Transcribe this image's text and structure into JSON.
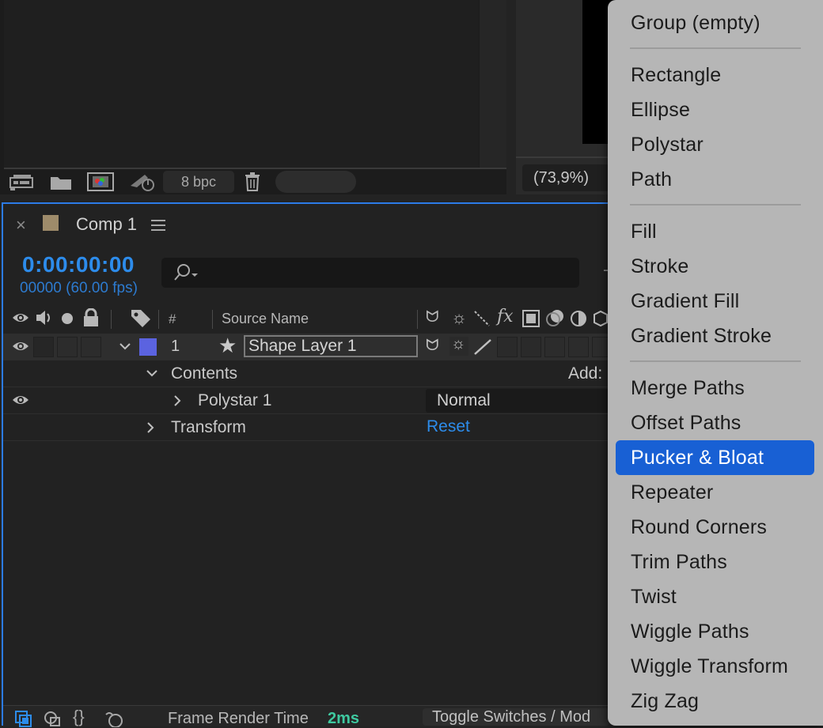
{
  "viewer_bar": {
    "bpc_label": "8 bpc",
    "zoom_label": "(73,9%)"
  },
  "comp_tab": {
    "title": "Comp 1",
    "label_color": "#9e8b6a"
  },
  "timeline": {
    "timecode": "0:00:00:00",
    "frame_info": "00000 (60.00 fps)",
    "search_placeholder": "",
    "columns": {
      "number": "#",
      "source_name": "Source Name"
    },
    "layer": {
      "number": "1",
      "name": "Shape Layer 1",
      "label_color": "#5b63e0"
    },
    "contents_label": "Contents",
    "add_label": "Add:",
    "polystar_label": "Polystar 1",
    "blend_mode": "Normal",
    "transform_label": "Transform",
    "reset_label": "Reset"
  },
  "status_bar": {
    "frame_render_label": "Frame Render Time",
    "frame_render_value": "2ms",
    "toggle_label": "Toggle Switches / Mod"
  },
  "add_menu": {
    "group1": [
      "Group (empty)"
    ],
    "group2": [
      "Rectangle",
      "Ellipse",
      "Polystar",
      "Path"
    ],
    "group3": [
      "Fill",
      "Stroke",
      "Gradient Fill",
      "Gradient Stroke"
    ],
    "group4": [
      "Merge Paths",
      "Offset Paths",
      "Pucker & Bloat",
      "Repeater",
      "Round Corners",
      "Trim Paths",
      "Twist",
      "Wiggle Paths",
      "Wiggle Transform",
      "Zig Zag"
    ],
    "selected": "Pucker & Bloat"
  },
  "colors": {
    "accent_blue": "#2d8ceb",
    "menu_selection": "#1860d4",
    "render_time_green": "#3ec9a0"
  }
}
